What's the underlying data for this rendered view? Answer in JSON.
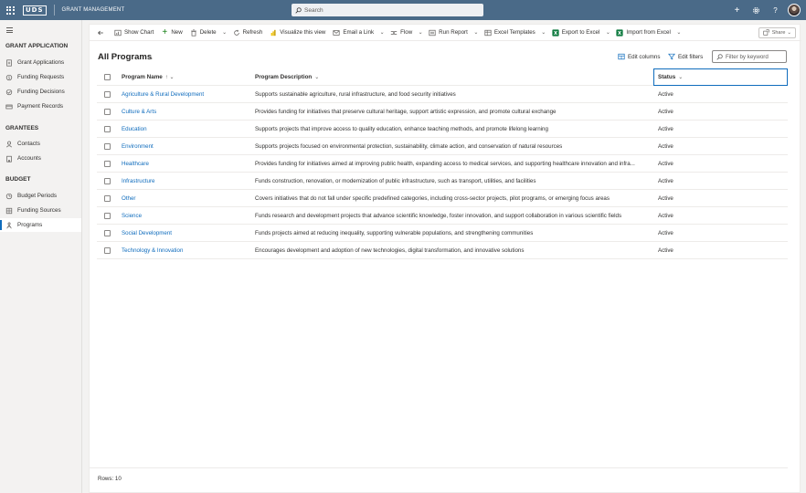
{
  "header": {
    "logo": "UDS",
    "app_title": "GRANT MANAGEMENT",
    "search_placeholder": "Search"
  },
  "sidebar": {
    "sections": [
      {
        "title": "GRANT APPLICATION",
        "items": [
          {
            "label": "Grant Applications",
            "icon": "document-icon"
          },
          {
            "label": "Funding Requests",
            "icon": "money-request-icon"
          },
          {
            "label": "Funding Decisions",
            "icon": "decision-icon"
          },
          {
            "label": "Payment Records",
            "icon": "payment-icon"
          }
        ]
      },
      {
        "title": "GRANTEES",
        "items": [
          {
            "label": "Contacts",
            "icon": "person-icon"
          },
          {
            "label": "Accounts",
            "icon": "building-icon"
          }
        ]
      },
      {
        "title": "BUDGET",
        "items": [
          {
            "label": "Budget Periods",
            "icon": "calendar-icon"
          },
          {
            "label": "Funding Sources",
            "icon": "source-icon"
          },
          {
            "label": "Programs",
            "icon": "program-icon",
            "active": true
          }
        ]
      }
    ]
  },
  "toolbar": {
    "show_chart": "Show Chart",
    "new": "New",
    "delete": "Delete",
    "refresh": "Refresh",
    "visualize": "Visualize this view",
    "email_link": "Email a Link",
    "flow": "Flow",
    "run_report": "Run Report",
    "excel_templates": "Excel Templates",
    "export_excel": "Export to Excel",
    "import_excel": "Import from Excel",
    "share": "Share"
  },
  "view": {
    "title": "All Programs",
    "edit_columns": "Edit columns",
    "edit_filters": "Edit filters",
    "filter_placeholder": "Filter by keyword"
  },
  "grid": {
    "columns": {
      "name": "Program Name",
      "name_sort": "↑ ⌄",
      "description": "Program Description",
      "status": "Status"
    },
    "rows": [
      {
        "name": "Agriculture & Rural Development",
        "description": "Supports sustainable agriculture, rural infrastructure, and food security initiatives",
        "status": "Active"
      },
      {
        "name": "Culture & Arts",
        "description": "Provides funding for initiatives that preserve cultural heritage, support artistic expression, and promote cultural exchange",
        "status": "Active"
      },
      {
        "name": "Education",
        "description": "Supports projects that improve access to quality education, enhance teaching methods, and promote lifelong learning",
        "status": "Active"
      },
      {
        "name": "Environment",
        "description": "Supports projects focused on environmental protection, sustainability, climate action, and conservation of natural resources",
        "status": "Active"
      },
      {
        "name": "Healthcare",
        "description": "Provides funding for initiatives aimed at improving public health, expanding access to medical services, and supporting healthcare innovation and infra...",
        "status": "Active"
      },
      {
        "name": "Infrastructure",
        "description": "Funds construction, renovation, or modernization of public infrastructure, such as transport, utilities, and facilities",
        "status": "Active"
      },
      {
        "name": "Other",
        "description": "Covers initiatives that do not fall under specific predefined categories, including cross-sector projects, pilot programs, or emerging focus areas",
        "status": "Active"
      },
      {
        "name": "Science",
        "description": "Funds research and development projects that advance scientific knowledge, foster innovation, and support collaboration in various scientific fields",
        "status": "Active"
      },
      {
        "name": "Social Development",
        "description": "Funds projects aimed at reducing inequality, supporting vulnerable populations, and strengthening communities",
        "status": "Active"
      },
      {
        "name": "Technology & Innovation",
        "description": "Encourages development and adoption of new technologies, digital transformation, and innovative solutions",
        "status": "Active"
      }
    ]
  },
  "footer": {
    "rows_label": "Rows: 10"
  },
  "colors": {
    "topbar": "#4a6a88",
    "link": "#0f6cbd",
    "accent": "#0f6cbd"
  }
}
